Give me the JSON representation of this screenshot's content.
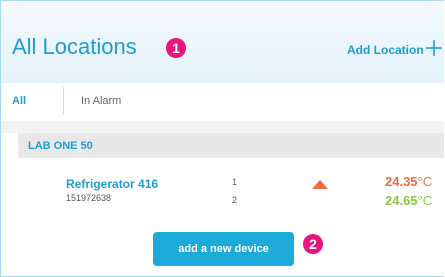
{
  "header": {
    "title": "All Locations",
    "badge": "1",
    "add_location_label": "Add Location"
  },
  "tabs": [
    {
      "label": "All",
      "active": true
    },
    {
      "label": "In Alarm",
      "active": false
    }
  ],
  "group": {
    "name": "LAB ONE 50",
    "devices": [
      {
        "name": "Refrigerator 416",
        "id": "151972638",
        "channels": [
          {
            "number": "1",
            "value": "24.35",
            "unit": "°C",
            "status": "alarm-high",
            "color": "#ef6b3b"
          },
          {
            "number": "2",
            "value": "24.65",
            "unit": "°C",
            "status": "ok",
            "color": "#8cc63e"
          }
        ],
        "trend_icon": "triangle-up-icon"
      }
    ]
  },
  "add_device": {
    "label": "add a new device",
    "badge": "2"
  },
  "colors": {
    "accent": "#1e9ed0",
    "badge": "#e8157f",
    "button": "#1eaad8",
    "alarm": "#ef6b3b",
    "ok": "#8cc63e"
  }
}
